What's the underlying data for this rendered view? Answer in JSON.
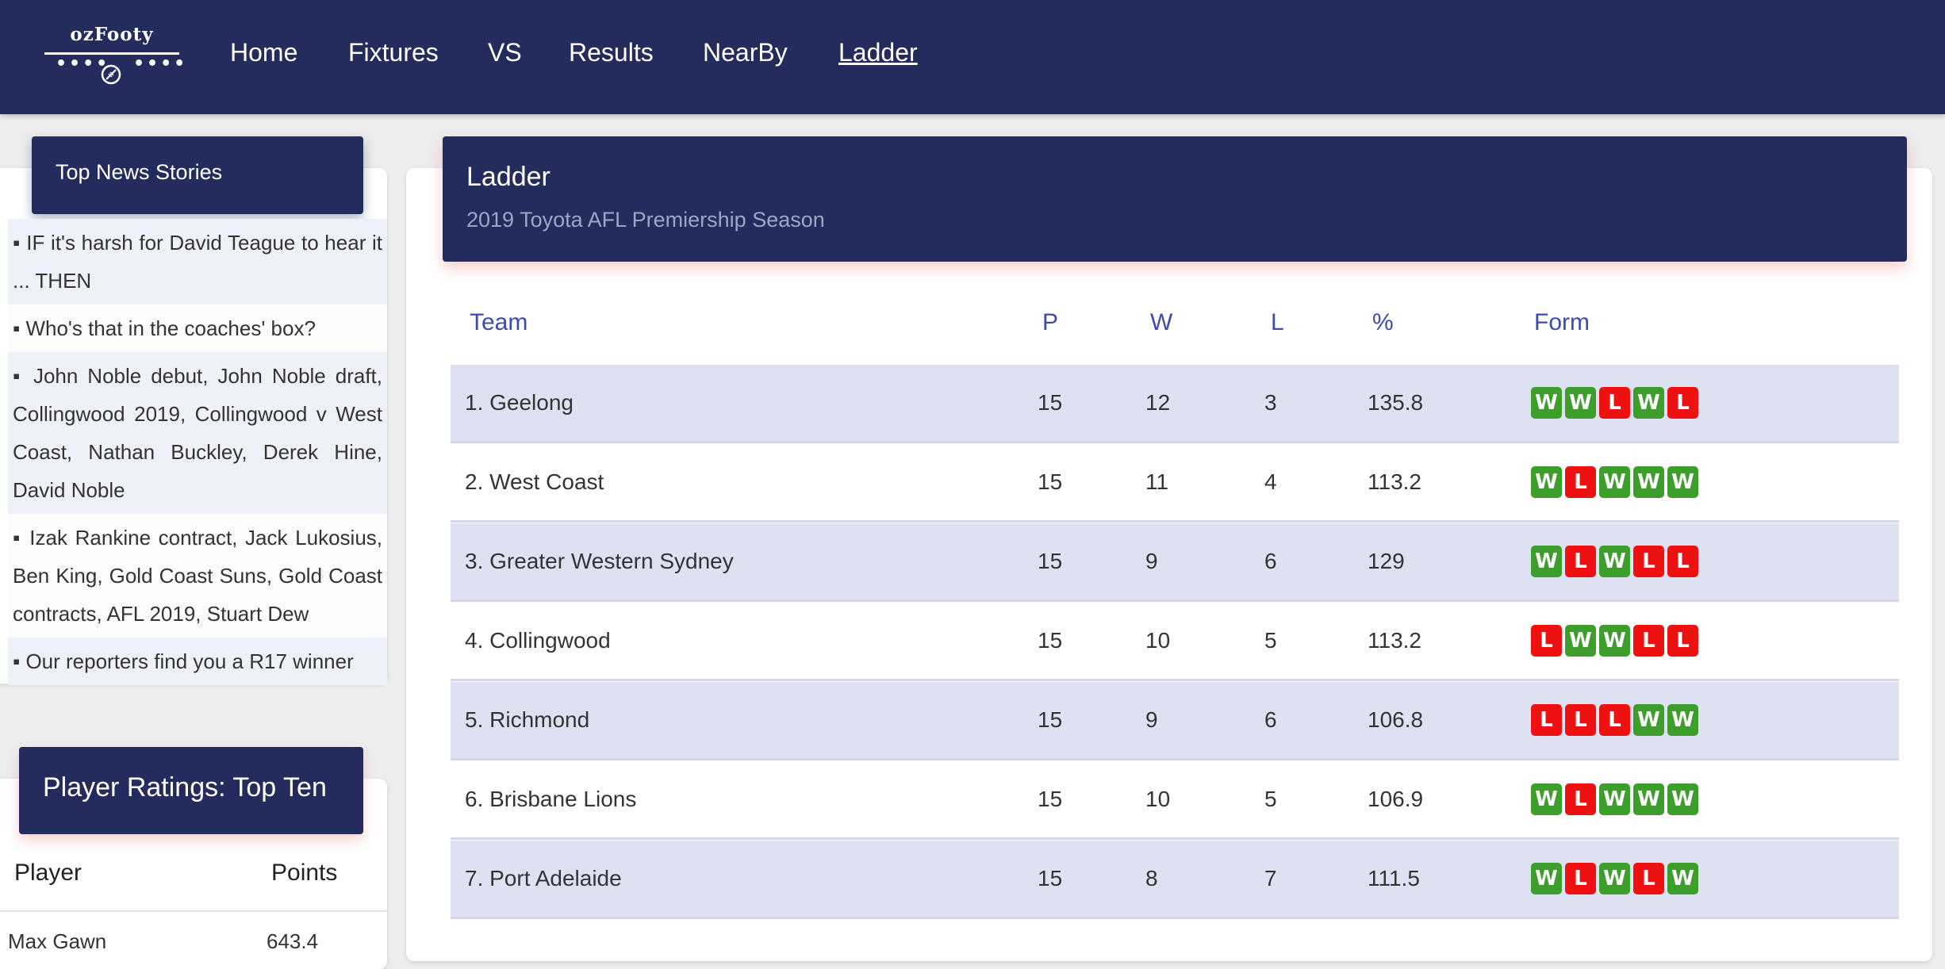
{
  "nav": {
    "logo_text": "ozFooty",
    "logo_dots": "••••",
    "links": [
      "Home",
      "Fixtures",
      "VS",
      "Results",
      "NearBy",
      "Ladder"
    ],
    "active": "Ladder"
  },
  "news": {
    "title": "Top News Stories",
    "items": [
      "▪ IF it's harsh for David Teague to hear it ... THEN",
      "▪ Who's that in the coaches' box?",
      "▪ John Noble debut, John Noble draft, Collingwood 2019, Collingwood v West Coast, Nathan Buckley, Derek Hine, David Noble",
      "▪ Izak Rankine contract, Jack Lukosius, Ben King, Gold Coast Suns, Gold Coast contracts, AFL 2019, Stuart Dew",
      "▪ Our reporters find you a R17 winner"
    ]
  },
  "players": {
    "title": "Player Ratings: Top Ten",
    "col_player": "Player",
    "col_points": "Points",
    "rows": [
      {
        "player": "Max Gawn",
        "points": "643.4"
      }
    ]
  },
  "ladder": {
    "title": "Ladder",
    "subtitle": "2019 Toyota AFL Premiership Season",
    "headers": {
      "team": "Team",
      "p": "P",
      "w": "W",
      "l": "L",
      "pct": "%",
      "form": "Form"
    },
    "rows": [
      {
        "team": "1. Geelong",
        "p": "15",
        "w": "12",
        "l": "3",
        "pct": "135.8",
        "form": [
          "W",
          "W",
          "L",
          "W",
          "L"
        ]
      },
      {
        "team": "2. West Coast",
        "p": "15",
        "w": "11",
        "l": "4",
        "pct": "113.2",
        "form": [
          "W",
          "L",
          "W",
          "W",
          "W"
        ]
      },
      {
        "team": "3. Greater Western Sydney",
        "p": "15",
        "w": "9",
        "l": "6",
        "pct": "129",
        "form": [
          "W",
          "L",
          "W",
          "L",
          "L"
        ]
      },
      {
        "team": "4. Collingwood",
        "p": "15",
        "w": "10",
        "l": "5",
        "pct": "113.2",
        "form": [
          "L",
          "W",
          "W",
          "L",
          "L"
        ]
      },
      {
        "team": "5. Richmond",
        "p": "15",
        "w": "9",
        "l": "6",
        "pct": "106.8",
        "form": [
          "L",
          "L",
          "L",
          "W",
          "W"
        ]
      },
      {
        "team": "6. Brisbane Lions",
        "p": "15",
        "w": "10",
        "l": "5",
        "pct": "106.9",
        "form": [
          "W",
          "L",
          "W",
          "W",
          "W"
        ]
      },
      {
        "team": "7. Port Adelaide",
        "p": "15",
        "w": "8",
        "l": "7",
        "pct": "111.5",
        "form": [
          "W",
          "L",
          "W",
          "L",
          "W"
        ]
      }
    ]
  },
  "colors": {
    "navy": "#232c5c",
    "win": "#3e9e2c",
    "loss": "#ee1111",
    "header_text": "#3c4bb0",
    "row_alt": "#dde1f2"
  }
}
